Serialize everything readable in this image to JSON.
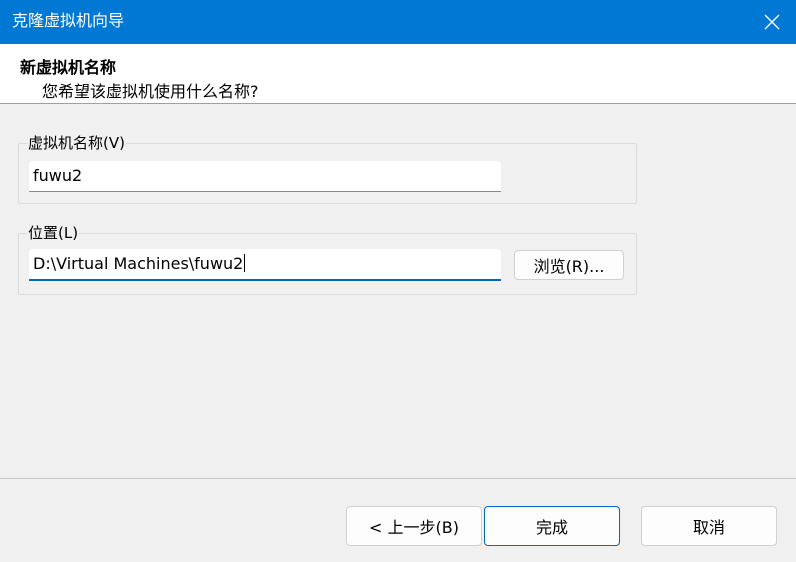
{
  "window": {
    "title": "克隆虚拟机向导",
    "accent_color": "#0078d4"
  },
  "header": {
    "heading": "新虚拟机名称",
    "subheading": "您希望该虚拟机使用什么名称?"
  },
  "name_group": {
    "label": "虚拟机名称(V)",
    "value": "fuwu2"
  },
  "location_group": {
    "label": "位置(L)",
    "value": "D:\\Virtual Machines\\fuwu2",
    "browse_label": "浏览(R)..."
  },
  "footer": {
    "back_label": "< 上一步(B)",
    "finish_label": "完成",
    "cancel_label": "取消"
  },
  "icons": {
    "close": "close-icon"
  }
}
